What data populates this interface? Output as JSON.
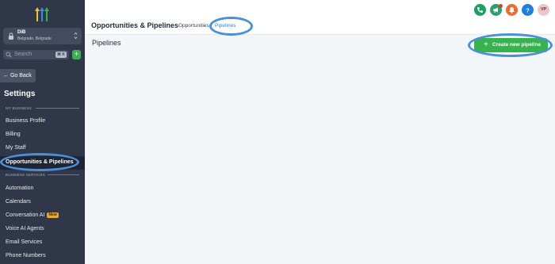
{
  "sidebar": {
    "location": {
      "name": "DiB",
      "address": "Belgrade, Belgrade"
    },
    "search": {
      "placeholder": "Search",
      "shortcut": "⌘ K"
    },
    "add_label": "+",
    "go_back": "← Go Back",
    "title": "Settings",
    "sections": {
      "my_business": "MY BUSINESS",
      "business_services": "BUSINESS SERVICES"
    },
    "items": [
      {
        "label": "Business Profile"
      },
      {
        "label": "Billing"
      },
      {
        "label": "My Staff"
      },
      {
        "label": "Opportunities & Pipelines",
        "active": true
      },
      {
        "label": "Automation"
      },
      {
        "label": "Calendars"
      },
      {
        "label": "Conversation AI",
        "badge": "New"
      },
      {
        "label": "Voice AI Agents"
      },
      {
        "label": "Email Services"
      },
      {
        "label": "Phone Numbers"
      }
    ]
  },
  "header": {
    "title": "Opportunities & Pipelines",
    "tabs": [
      {
        "label": "Opportunities"
      },
      {
        "label": "Pipelines",
        "active": true
      }
    ],
    "icons": [
      "phone-icon",
      "megaphone-icon",
      "bell-icon",
      "help-icon"
    ],
    "avatar": "VP"
  },
  "main": {
    "heading": "Pipelines",
    "create_button": {
      "icon": "+",
      "label": "Create new pipeline"
    }
  },
  "colors": {
    "sidebar_bg": "#2f3748",
    "accent_green": "#37b24d",
    "tab_active": "#1e88e5",
    "highlight": "#4a90d9"
  }
}
